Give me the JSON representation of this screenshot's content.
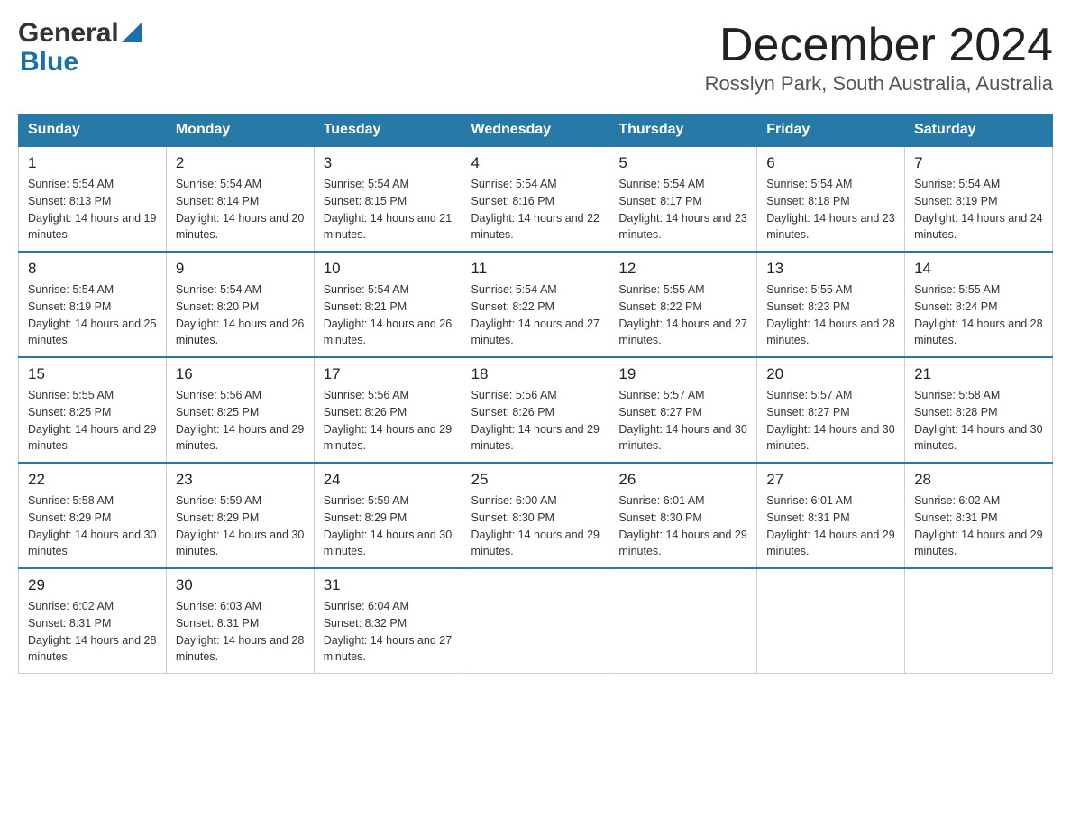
{
  "header": {
    "logo_general": "General",
    "logo_blue": "Blue",
    "month_year": "December 2024",
    "location": "Rosslyn Park, South Australia, Australia"
  },
  "weekdays": [
    "Sunday",
    "Monday",
    "Tuesday",
    "Wednesday",
    "Thursday",
    "Friday",
    "Saturday"
  ],
  "weeks": [
    [
      {
        "day": "1",
        "sunrise": "5:54 AM",
        "sunset": "8:13 PM",
        "daylight": "14 hours and 19 minutes."
      },
      {
        "day": "2",
        "sunrise": "5:54 AM",
        "sunset": "8:14 PM",
        "daylight": "14 hours and 20 minutes."
      },
      {
        "day": "3",
        "sunrise": "5:54 AM",
        "sunset": "8:15 PM",
        "daylight": "14 hours and 21 minutes."
      },
      {
        "day": "4",
        "sunrise": "5:54 AM",
        "sunset": "8:16 PM",
        "daylight": "14 hours and 22 minutes."
      },
      {
        "day": "5",
        "sunrise": "5:54 AM",
        "sunset": "8:17 PM",
        "daylight": "14 hours and 23 minutes."
      },
      {
        "day": "6",
        "sunrise": "5:54 AM",
        "sunset": "8:18 PM",
        "daylight": "14 hours and 23 minutes."
      },
      {
        "day": "7",
        "sunrise": "5:54 AM",
        "sunset": "8:19 PM",
        "daylight": "14 hours and 24 minutes."
      }
    ],
    [
      {
        "day": "8",
        "sunrise": "5:54 AM",
        "sunset": "8:19 PM",
        "daylight": "14 hours and 25 minutes."
      },
      {
        "day": "9",
        "sunrise": "5:54 AM",
        "sunset": "8:20 PM",
        "daylight": "14 hours and 26 minutes."
      },
      {
        "day": "10",
        "sunrise": "5:54 AM",
        "sunset": "8:21 PM",
        "daylight": "14 hours and 26 minutes."
      },
      {
        "day": "11",
        "sunrise": "5:54 AM",
        "sunset": "8:22 PM",
        "daylight": "14 hours and 27 minutes."
      },
      {
        "day": "12",
        "sunrise": "5:55 AM",
        "sunset": "8:22 PM",
        "daylight": "14 hours and 27 minutes."
      },
      {
        "day": "13",
        "sunrise": "5:55 AM",
        "sunset": "8:23 PM",
        "daylight": "14 hours and 28 minutes."
      },
      {
        "day": "14",
        "sunrise": "5:55 AM",
        "sunset": "8:24 PM",
        "daylight": "14 hours and 28 minutes."
      }
    ],
    [
      {
        "day": "15",
        "sunrise": "5:55 AM",
        "sunset": "8:25 PM",
        "daylight": "14 hours and 29 minutes."
      },
      {
        "day": "16",
        "sunrise": "5:56 AM",
        "sunset": "8:25 PM",
        "daylight": "14 hours and 29 minutes."
      },
      {
        "day": "17",
        "sunrise": "5:56 AM",
        "sunset": "8:26 PM",
        "daylight": "14 hours and 29 minutes."
      },
      {
        "day": "18",
        "sunrise": "5:56 AM",
        "sunset": "8:26 PM",
        "daylight": "14 hours and 29 minutes."
      },
      {
        "day": "19",
        "sunrise": "5:57 AM",
        "sunset": "8:27 PM",
        "daylight": "14 hours and 30 minutes."
      },
      {
        "day": "20",
        "sunrise": "5:57 AM",
        "sunset": "8:27 PM",
        "daylight": "14 hours and 30 minutes."
      },
      {
        "day": "21",
        "sunrise": "5:58 AM",
        "sunset": "8:28 PM",
        "daylight": "14 hours and 30 minutes."
      }
    ],
    [
      {
        "day": "22",
        "sunrise": "5:58 AM",
        "sunset": "8:29 PM",
        "daylight": "14 hours and 30 minutes."
      },
      {
        "day": "23",
        "sunrise": "5:59 AM",
        "sunset": "8:29 PM",
        "daylight": "14 hours and 30 minutes."
      },
      {
        "day": "24",
        "sunrise": "5:59 AM",
        "sunset": "8:29 PM",
        "daylight": "14 hours and 30 minutes."
      },
      {
        "day": "25",
        "sunrise": "6:00 AM",
        "sunset": "8:30 PM",
        "daylight": "14 hours and 29 minutes."
      },
      {
        "day": "26",
        "sunrise": "6:01 AM",
        "sunset": "8:30 PM",
        "daylight": "14 hours and 29 minutes."
      },
      {
        "day": "27",
        "sunrise": "6:01 AM",
        "sunset": "8:31 PM",
        "daylight": "14 hours and 29 minutes."
      },
      {
        "day": "28",
        "sunrise": "6:02 AM",
        "sunset": "8:31 PM",
        "daylight": "14 hours and 29 minutes."
      }
    ],
    [
      {
        "day": "29",
        "sunrise": "6:02 AM",
        "sunset": "8:31 PM",
        "daylight": "14 hours and 28 minutes."
      },
      {
        "day": "30",
        "sunrise": "6:03 AM",
        "sunset": "8:31 PM",
        "daylight": "14 hours and 28 minutes."
      },
      {
        "day": "31",
        "sunrise": "6:04 AM",
        "sunset": "8:32 PM",
        "daylight": "14 hours and 27 minutes."
      },
      null,
      null,
      null,
      null
    ]
  ]
}
